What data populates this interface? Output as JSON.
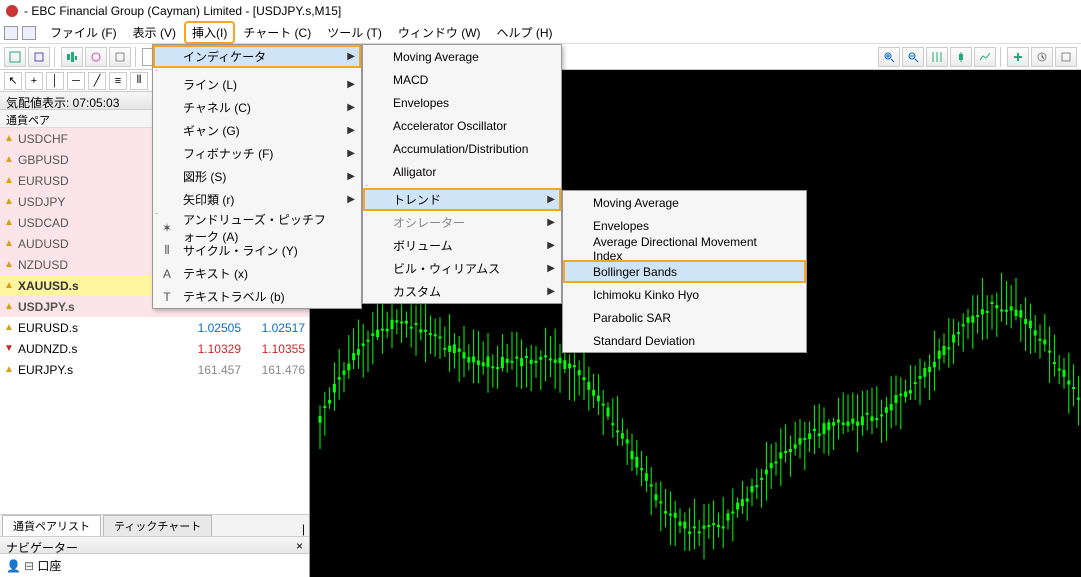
{
  "title": "- EBC Financial Group (Cayman) Limited - [USDJPY.s,M15]",
  "menu": {
    "file": "ファイル (F)",
    "view": "表示 (V)",
    "insert": "挿入(I)",
    "charts": "チャート (C)",
    "tools": "ツール (T)",
    "window": "ウィンドウ (W)",
    "help": "ヘルプ (H)"
  },
  "priceHeader": "気配値表示: 07:05:03",
  "colHeader": "通貨ペア",
  "symbols": [
    {
      "name": "USDCHF",
      "cls": "pink",
      "dir": "up"
    },
    {
      "name": "GBPUSD",
      "cls": "pink",
      "dir": "up"
    },
    {
      "name": "EURUSD",
      "cls": "pink",
      "dir": "up"
    },
    {
      "name": "USDJPY",
      "cls": "pink",
      "dir": "up"
    },
    {
      "name": "USDCAD",
      "cls": "pink",
      "dir": "up"
    },
    {
      "name": "AUDUSD",
      "cls": "pink",
      "dir": "up"
    },
    {
      "name": "NZDUSD",
      "cls": "pink",
      "dir": "up"
    },
    {
      "name": "XAUUSD.s",
      "cls": "yellow",
      "dir": "up"
    },
    {
      "name": "USDJPY.s",
      "cls": "pink red",
      "dir": "up"
    },
    {
      "name": "EURUSD.s",
      "cls": "plain",
      "dir": "up",
      "bid": "1.02505",
      "ask": "1.02517",
      "col": "up"
    },
    {
      "name": "AUDNZD.s",
      "cls": "plain",
      "dir": "dn",
      "bid": "1.10329",
      "ask": "1.10355",
      "col": "dn"
    },
    {
      "name": "EURJPY.s",
      "cls": "plain",
      "dir": "up",
      "bid": "161.457",
      "ask": "161.476",
      "col": "gr"
    }
  ],
  "tabs": {
    "pairs": "通貨ペアリスト",
    "tick": "ティックチャート"
  },
  "navHeader": "ナビゲーター",
  "navNode": "口座",
  "insertMenu": [
    {
      "label": "インディケータ",
      "arrow": true,
      "hover": true,
      "highlight": true
    },
    {
      "sep": true
    },
    {
      "label": "ライン (L)",
      "arrow": true
    },
    {
      "label": "チャネル (C)",
      "arrow": true
    },
    {
      "label": "ギャン (G)",
      "arrow": true
    },
    {
      "label": "フィボナッチ (F)",
      "arrow": true
    },
    {
      "label": "図形 (S)",
      "arrow": true
    },
    {
      "label": "矢印類 (r)",
      "arrow": true
    },
    {
      "sep": true
    },
    {
      "label": "アンドリューズ・ピッチフォーク (A)",
      "icon": "✶"
    },
    {
      "label": "サイクル・ライン (Y)",
      "icon": "⦀"
    },
    {
      "label": "テキスト (x)",
      "icon": "A"
    },
    {
      "label": "テキストラベル (b)",
      "icon": "T"
    }
  ],
  "indicatorMenu": [
    {
      "label": "Moving Average"
    },
    {
      "label": "MACD"
    },
    {
      "label": "Envelopes"
    },
    {
      "label": "Accelerator Oscillator"
    },
    {
      "label": "Accumulation/Distribution"
    },
    {
      "label": "Alligator"
    },
    {
      "sep": true
    },
    {
      "label": "トレンド",
      "arrow": true,
      "hover": true,
      "highlight": true
    },
    {
      "label": "オシレーター",
      "arrow": true,
      "disabled": true
    },
    {
      "label": "ボリューム",
      "arrow": true
    },
    {
      "label": "ビル・ウィリアムス",
      "arrow": true
    },
    {
      "label": "カスタム",
      "arrow": true
    }
  ],
  "trendMenu": [
    {
      "label": "Moving Average"
    },
    {
      "label": "Envelopes"
    },
    {
      "label": "Average Directional Movement Index"
    },
    {
      "label": "Bollinger Bands",
      "hover": true,
      "highlight": true
    },
    {
      "label": "Ichimoku Kinko Hyo"
    },
    {
      "label": "Parabolic SAR"
    },
    {
      "label": "Standard Deviation"
    }
  ]
}
